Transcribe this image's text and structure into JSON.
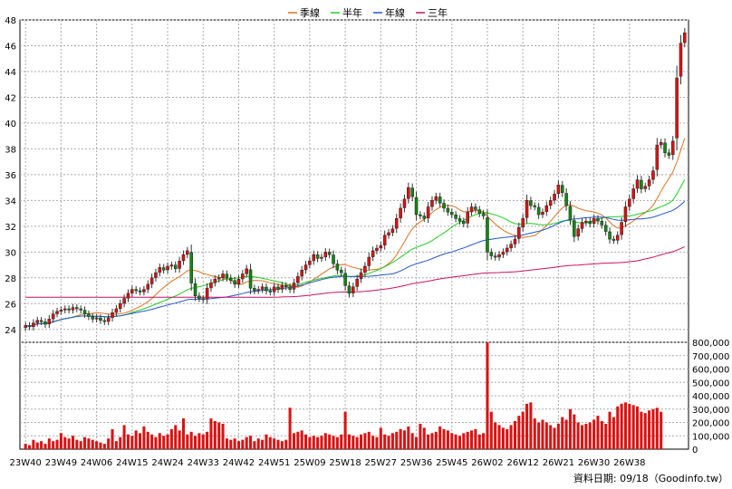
{
  "chart_data": {
    "type": "candlestick",
    "legend": [
      {
        "name": "季線",
        "color": "#e07020"
      },
      {
        "name": "半年",
        "color": "#22cc22"
      },
      {
        "name": "年線",
        "color": "#2255cc"
      },
      {
        "name": "三年",
        "color": "#cc1166"
      }
    ],
    "price_axis": {
      "min": 23,
      "max": 48,
      "ticks": [
        24,
        26,
        28,
        30,
        32,
        34,
        36,
        38,
        40,
        42,
        44,
        46,
        48
      ],
      "side": "left"
    },
    "volume_axis": {
      "min": 0,
      "max": 800000,
      "side": "right",
      "ticks": [
        0,
        100000,
        200000,
        300000,
        400000,
        500000,
        600000,
        700000,
        800000
      ],
      "tick_labels": [
        "0",
        "100,000",
        "200,000",
        "300,000",
        "400,000",
        "500,000",
        "600,000",
        "700,000",
        "800,000"
      ]
    },
    "x_labels": [
      "23W40",
      "23W49",
      "24W06",
      "24W15",
      "24W24",
      "24W33",
      "24W42",
      "24W51",
      "25W09",
      "25W18",
      "25W27",
      "25W36",
      "25W45",
      "26W02",
      "26W12",
      "26W21",
      "26W30",
      "26W38"
    ],
    "weeks_per_label": 9,
    "total_weeks": 157,
    "up_color": "#dd1111",
    "down_color": "#118811",
    "close": [
      24.3,
      24.2,
      24.5,
      24.7,
      24.6,
      24.4,
      24.8,
      25.2,
      25.4,
      25.5,
      25.6,
      25.5,
      25.7,
      25.6,
      25.5,
      25.2,
      25.0,
      24.8,
      24.9,
      24.7,
      24.6,
      24.9,
      25.3,
      25.6,
      26.0,
      26.4,
      26.8,
      27.1,
      27.0,
      26.9,
      27.1,
      27.5,
      28.0,
      28.4,
      28.8,
      28.6,
      28.9,
      29.0,
      28.7,
      29.3,
      29.8,
      30.1,
      27.6,
      26.6,
      26.4,
      26.3,
      27.2,
      27.6,
      27.9,
      28.0,
      28.3,
      28.0,
      27.8,
      27.5,
      27.9,
      28.3,
      28.7,
      27.2,
      27.0,
      27.1,
      27.3,
      27.0,
      26.9,
      27.3,
      27.1,
      27.4,
      27.3,
      27.1,
      27.6,
      28.1,
      28.6,
      29.0,
      29.3,
      29.8,
      29.5,
      29.6,
      30.0,
      29.8,
      29.1,
      28.6,
      28.4,
      27.4,
      26.8,
      27.3,
      27.9,
      28.4,
      28.9,
      29.6,
      30.1,
      30.3,
      30.5,
      31.3,
      31.5,
      31.8,
      32.6,
      33.4,
      34.1,
      35.0,
      34.3,
      32.9,
      32.8,
      32.6,
      33.5,
      34.0,
      34.3,
      33.8,
      33.4,
      33.1,
      32.9,
      32.6,
      32.4,
      32.2,
      33.1,
      33.5,
      33.3,
      33.0,
      32.8,
      30.0,
      29.7,
      29.6,
      29.8,
      30.0,
      30.3,
      30.6,
      31.0,
      31.9,
      32.6,
      34.0,
      33.6,
      33.5,
      32.9,
      33.1,
      33.6,
      34.0,
      34.5,
      35.2,
      34.6,
      33.6,
      32.5,
      31.2,
      31.8,
      32.3,
      32.4,
      32.2,
      32.6,
      32.4,
      32.1,
      31.6,
      31.0,
      30.9,
      31.3,
      32.3,
      33.5,
      34.1,
      34.9,
      35.6,
      34.9,
      35.1,
      35.6,
      36.3,
      38.3,
      38.5,
      37.7,
      37.5,
      38.6,
      43.5,
      46.2,
      47.0
    ],
    "volume": [
      40000,
      30000,
      70000,
      50000,
      60000,
      40000,
      80000,
      60000,
      70000,
      120000,
      90000,
      80000,
      100000,
      70000,
      60000,
      90000,
      80000,
      70000,
      60000,
      50000,
      40000,
      80000,
      150000,
      60000,
      90000,
      180000,
      110000,
      100000,
      140000,
      120000,
      170000,
      130000,
      110000,
      90000,
      120000,
      100000,
      110000,
      150000,
      180000,
      140000,
      230000,
      110000,
      130000,
      100000,
      120000,
      110000,
      130000,
      230000,
      210000,
      200000,
      190000,
      80000,
      70000,
      80000,
      60000,
      70000,
      90000,
      100000,
      60000,
      80000,
      70000,
      110000,
      90000,
      80000,
      70000,
      60000,
      70000,
      310000,
      120000,
      130000,
      140000,
      110000,
      90000,
      100000,
      90000,
      100000,
      120000,
      110000,
      100000,
      90000,
      110000,
      280000,
      110000,
      100000,
      90000,
      110000,
      120000,
      130000,
      100000,
      90000,
      160000,
      110000,
      100000,
      120000,
      130000,
      150000,
      140000,
      170000,
      120000,
      90000,
      190000,
      160000,
      110000,
      120000,
      130000,
      170000,
      150000,
      140000,
      120000,
      110000,
      100000,
      120000,
      130000,
      140000,
      150000,
      110000,
      120000,
      830000,
      280000,
      200000,
      180000,
      160000,
      150000,
      180000,
      210000,
      250000,
      280000,
      340000,
      350000,
      230000,
      200000,
      220000,
      200000,
      180000,
      160000,
      190000,
      240000,
      220000,
      300000,
      260000,
      200000,
      180000,
      190000,
      200000,
      220000,
      250000,
      210000,
      190000,
      280000,
      240000,
      320000,
      340000,
      350000,
      340000,
      330000,
      320000,
      280000,
      270000,
      290000,
      300000,
      310000,
      280000
    ],
    "footer": "資料日期: 09/18（Goodinfo.tw）"
  }
}
